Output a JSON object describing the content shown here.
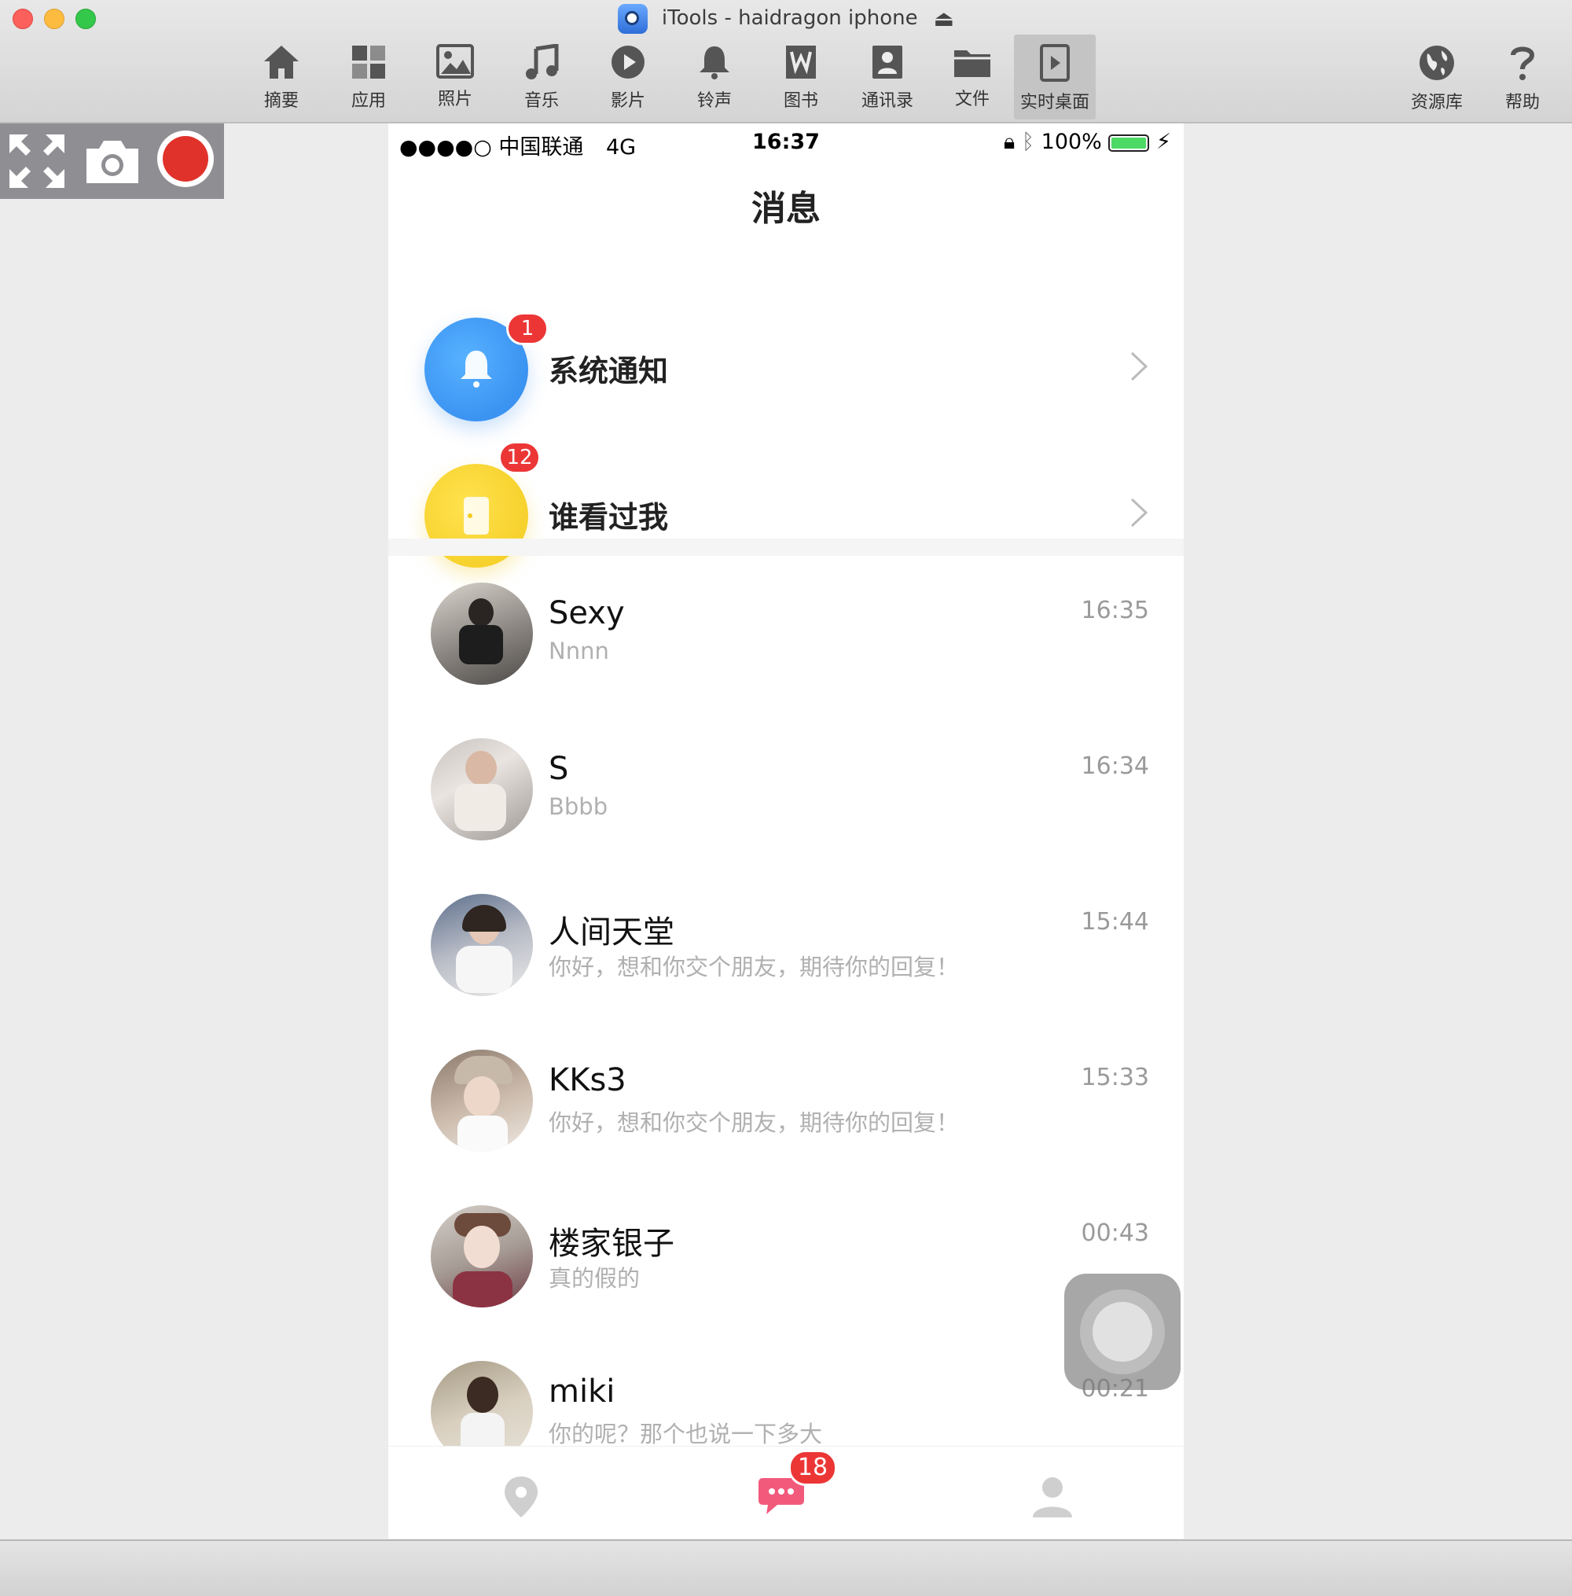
{
  "window": {
    "title": "iTools - haidragon iphone"
  },
  "toolbar": {
    "items": [
      {
        "label": "摘要",
        "icon": "home-icon"
      },
      {
        "label": "应用",
        "icon": "apps-icon"
      },
      {
        "label": "照片",
        "icon": "photo-icon"
      },
      {
        "label": "音乐",
        "icon": "music-icon"
      },
      {
        "label": "影片",
        "icon": "play-icon"
      },
      {
        "label": "铃声",
        "icon": "bell-icon"
      },
      {
        "label": "图书",
        "icon": "book-icon"
      },
      {
        "label": "通讯录",
        "icon": "contacts-icon"
      },
      {
        "label": "文件",
        "icon": "folder-icon"
      },
      {
        "label": "实时桌面",
        "icon": "live-desktop-icon"
      }
    ],
    "right_items": [
      {
        "label": "资源库",
        "icon": "globe-icon"
      },
      {
        "label": "帮助",
        "icon": "help-icon"
      }
    ],
    "active": "实时桌面"
  },
  "side_tools": {
    "icons": [
      "fullscreen-icon",
      "camera-icon",
      "record-icon"
    ]
  },
  "phone": {
    "status": {
      "signal": "●●●●○",
      "carrier": "中国联通",
      "network": "4G",
      "time": "16:37",
      "battery": "100%"
    },
    "page_title": "消息",
    "system_rows": [
      {
        "label": "系统通知",
        "badge": "1",
        "color": "#3b96f3"
      },
      {
        "label": "谁看过我",
        "badge": "12",
        "color": "#f5d327"
      }
    ],
    "conversations": [
      {
        "name": "Sexy",
        "preview": "Nnnn",
        "time": "16:35"
      },
      {
        "name": "S",
        "preview": "Bbbb",
        "time": "16:34"
      },
      {
        "name": "人间天堂",
        "preview": "你好，想和你交个朋友，期待你的回复！",
        "time": "15:44"
      },
      {
        "name": "KKs3",
        "preview": "你好，想和你交个朋友，期待你的回复！",
        "time": "15:33"
      },
      {
        "name": "楼家银子",
        "preview": "真的假的",
        "time": "00:43"
      },
      {
        "name": "miki",
        "preview": "你的呢？那个也说一下多大",
        "time": "00:21"
      }
    ],
    "tabbar": {
      "message_badge": "18",
      "icons": [
        "location-icon",
        "messages-icon",
        "profile-icon"
      ]
    }
  },
  "colors": {
    "accent_red": "#ec3636",
    "record_red": "#e0322b",
    "message_tab": "#f25a7c"
  }
}
